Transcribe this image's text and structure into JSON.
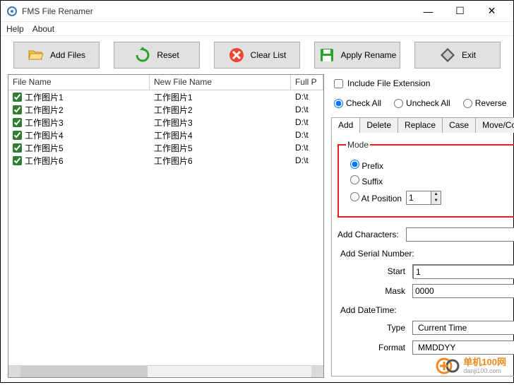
{
  "window": {
    "title": "FMS File Renamer",
    "minimize": "—",
    "maximize": "☐",
    "close": "✕"
  },
  "menu": {
    "help": "Help",
    "about": "About"
  },
  "toolbar": {
    "add_files": "Add Files",
    "reset": "Reset",
    "clear_list": "Clear List",
    "apply_rename": "Apply Rename",
    "exit": "Exit"
  },
  "file_list": {
    "headers": {
      "name": "File Name",
      "newname": "New File Name",
      "path": "Full P"
    },
    "rows": [
      {
        "checked": true,
        "name": "工作图片1",
        "newname": "工作图片1",
        "path": "D:\\t"
      },
      {
        "checked": true,
        "name": "工作图片2",
        "newname": "工作图片2",
        "path": "D:\\t"
      },
      {
        "checked": true,
        "name": "工作图片3",
        "newname": "工作图片3",
        "path": "D:\\t"
      },
      {
        "checked": true,
        "name": "工作图片4",
        "newname": "工作图片4",
        "path": "D:\\t"
      },
      {
        "checked": true,
        "name": "工作图片5",
        "newname": "工作图片5",
        "path": "D:\\t"
      },
      {
        "checked": true,
        "name": "工作图片6",
        "newname": "工作图片6",
        "path": "D:\\t"
      }
    ]
  },
  "options": {
    "include_ext": "Include File Extension",
    "check_all": "Check All",
    "uncheck_all": "Uncheck All",
    "reverse": "Reverse"
  },
  "tabs": {
    "add": "Add",
    "delete": "Delete",
    "replace": "Replace",
    "case": "Case",
    "movecopy": "Move/Copy"
  },
  "add_tab": {
    "mode_legend": "Mode",
    "prefix": "Prefix",
    "suffix": "Suffix",
    "at_position": "At Position",
    "at_position_value": "1",
    "add_characters_label": "Add Characters:",
    "add_characters_value": "",
    "add_serial_label": "Add Serial Number:",
    "start_label": "Start",
    "start_value": "1",
    "mask_label": "Mask",
    "mask_value": "0000",
    "add_datetime_label": "Add DateTime:",
    "type_label": "Type",
    "type_value": "Current Time",
    "format_label": "Format",
    "format_value": "MMDDYY"
  },
  "watermark": {
    "line1": "单机100网",
    "line2": "danji100.com"
  },
  "icons": {
    "check": "✓"
  }
}
